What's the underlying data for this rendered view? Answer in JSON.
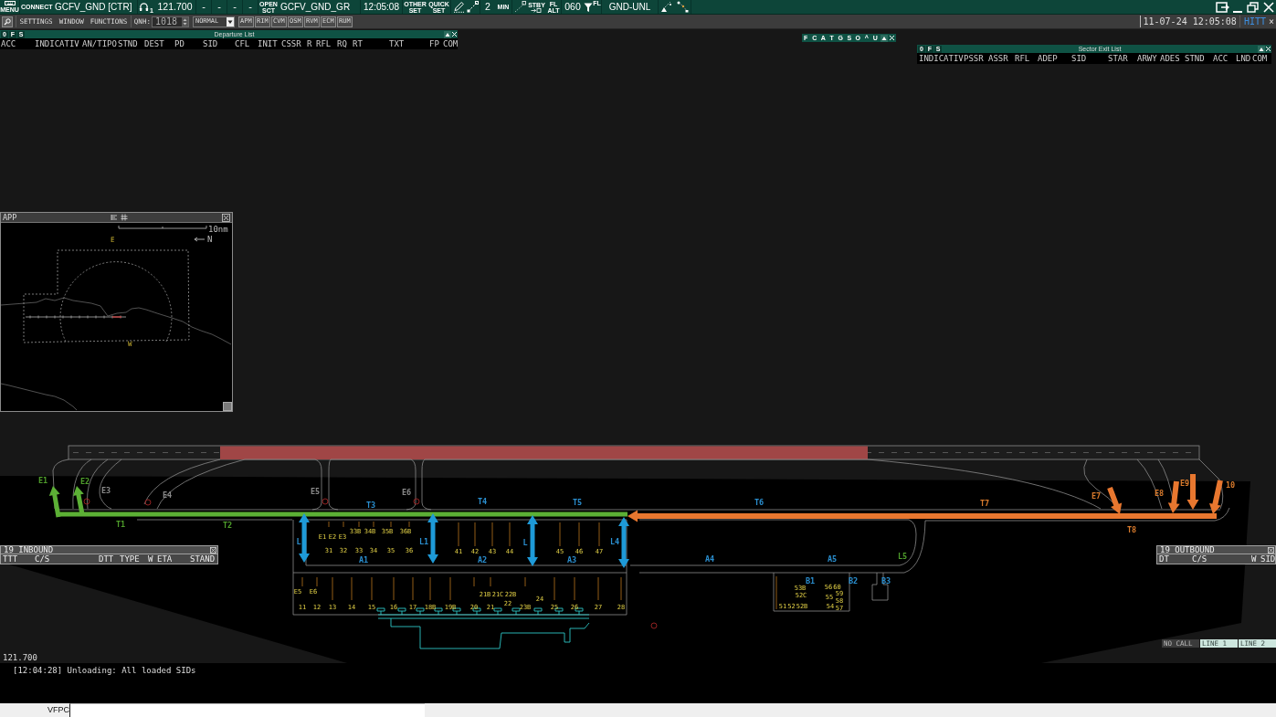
{
  "top_bar": {
    "menu": "MENU",
    "connect": "CONNECT",
    "callsign": "GCFV_GND [CTR]",
    "voice_channel": "1",
    "frequency": "121.700",
    "dashes": [
      "-",
      "-",
      "-",
      "-"
    ],
    "open_sector": [
      "OPEN",
      "SCT"
    ],
    "sector": "GCFV_GND_GR",
    "time": "12:05:08",
    "set_buttons": [
      [
        "OTHER",
        "SET"
      ],
      [
        "QUICK",
        "SET"
      ]
    ],
    "minutes": "2",
    "minutes_unit": "MIN",
    "standby": "STBY",
    "fl_alt": [
      "FL",
      "ALT"
    ],
    "fl_value": "060",
    "filter": "FL",
    "altitude_range": "GND-UNL"
  },
  "toolbar": {
    "menus": [
      "SETTINGS",
      "WINDOW",
      "FUNCTIONS"
    ],
    "qnh_label": "QNH:",
    "qnh_value": "1018",
    "mode": "NORMAL",
    "view_buttons": [
      "APM",
      "RIM",
      "CVM",
      "OSM",
      "RVM",
      "ECM",
      "RUM"
    ],
    "datetime": "11-07-24 12:05:08",
    "user": "HITT",
    "close": "×"
  },
  "departure_list": {
    "flags": [
      "0",
      "F",
      "S"
    ],
    "title": "Departure List",
    "columns": [
      "ACC",
      "INDICATIV",
      "AN/TIPO",
      "STND",
      "DEST",
      "PD",
      "SID",
      "CFL",
      "INIT",
      "CSSR",
      "R",
      "RFL",
      "RQ",
      "RT",
      "TXT",
      "FP",
      "COM"
    ]
  },
  "tag_filter_bar": {
    "letters": [
      "F",
      "C",
      "A",
      "T",
      "G",
      "S",
      "O",
      "^",
      "U"
    ]
  },
  "sector_exit_list": {
    "flags": [
      "0",
      "F",
      "S"
    ],
    "title": "Sector Exit List",
    "columns": [
      "INDICATIV",
      "PSSR",
      "ASSR",
      "RFL",
      "ADEP",
      "SID",
      "STAR",
      "ARWY",
      "ADES",
      "STND",
      "ACC",
      "LND",
      "COM"
    ]
  },
  "app_window": {
    "title": "APP",
    "scale": "10nm",
    "north": "N",
    "fix_labels": [
      "E",
      "W"
    ]
  },
  "map": {
    "labels": [
      {
        "text": "E1",
        "color": "#4f9e2b"
      },
      {
        "text": "E2",
        "color": "#4f9e2b"
      },
      {
        "text": "E3",
        "color": "#8a8a8a"
      },
      {
        "text": "E4",
        "color": "#8a8a8a"
      },
      {
        "text": "E5",
        "color": "#8a8a8a"
      },
      {
        "text": "E6",
        "color": "#8a8a8a"
      },
      {
        "text": "E7",
        "color": "#d87a2c"
      },
      {
        "text": "E8",
        "color": "#d87a2c"
      },
      {
        "text": "E9",
        "color": "#d87a2c"
      },
      {
        "text": "10",
        "color": "#d87a2c"
      },
      {
        "text": "T1",
        "color": "#4f9e2b"
      },
      {
        "text": "T2",
        "color": "#4f9e2b"
      },
      {
        "text": "T3",
        "color": "#2a8fd0"
      },
      {
        "text": "T4",
        "color": "#2a8fd0"
      },
      {
        "text": "T5",
        "color": "#2a8fd0"
      },
      {
        "text": "T6",
        "color": "#2a8fd0"
      },
      {
        "text": "T7",
        "color": "#d87a2c"
      },
      {
        "text": "T8",
        "color": "#d87a2c"
      },
      {
        "text": "L",
        "color": "#2a8fd0"
      },
      {
        "text": "L1",
        "color": "#2a8fd0"
      },
      {
        "text": "L",
        "color": "#2a8fd0"
      },
      {
        "text": "L4",
        "color": "#2a8fd0"
      },
      {
        "text": "L5",
        "color": "#4f9e2b"
      },
      {
        "text": "A1",
        "color": "#2a8fd0"
      },
      {
        "text": "A2",
        "color": "#2a8fd0"
      },
      {
        "text": "A3",
        "color": "#2a8fd0"
      },
      {
        "text": "A4",
        "color": "#2a8fd0"
      },
      {
        "text": "A5",
        "color": "#2a8fd0"
      },
      {
        "text": "B1",
        "color": "#2a8fd0"
      },
      {
        "text": "B2",
        "color": "#2a8fd0"
      },
      {
        "text": "B3",
        "color": "#2a8fd0"
      }
    ],
    "stands": [
      "E1",
      "E2",
      "E3",
      "33B",
      "34B",
      "35B",
      "36B",
      "31",
      "32",
      "33",
      "34",
      "35",
      "36",
      "41",
      "42",
      "43",
      "44",
      "45",
      "46",
      "47",
      "E5",
      "E6",
      "21B",
      "21C",
      "22B",
      "22",
      "24",
      "11",
      "12",
      "13",
      "14",
      "15",
      "16",
      "17",
      "18B",
      "19B",
      "20",
      "21",
      "23B",
      "25",
      "26",
      "27",
      "28",
      "53B",
      "52C",
      "51",
      "52",
      "52B",
      "56",
      "60",
      "55",
      "59",
      "58",
      "54",
      "57"
    ]
  },
  "inbound_list": {
    "title": "19 INBOUND",
    "columns": [
      "TTT",
      "C/S",
      "DTT",
      "TYPE",
      "W",
      "ETA",
      "STAND"
    ]
  },
  "outbound_list": {
    "title": "19 OUTBOUND",
    "columns": [
      "DT",
      "C/S",
      "W",
      "SID"
    ]
  },
  "frequency_readout": "121.700",
  "voice_status": [
    {
      "label": "NO CALL",
      "active": false
    },
    {
      "label": "LINE 1",
      "active": true
    },
    {
      "label": "LINE 2",
      "active": true
    }
  ],
  "messages": [
    "[12:04:28] Unloading: All loaded SIDs"
  ],
  "command_line": {
    "label": "VFPC"
  }
}
